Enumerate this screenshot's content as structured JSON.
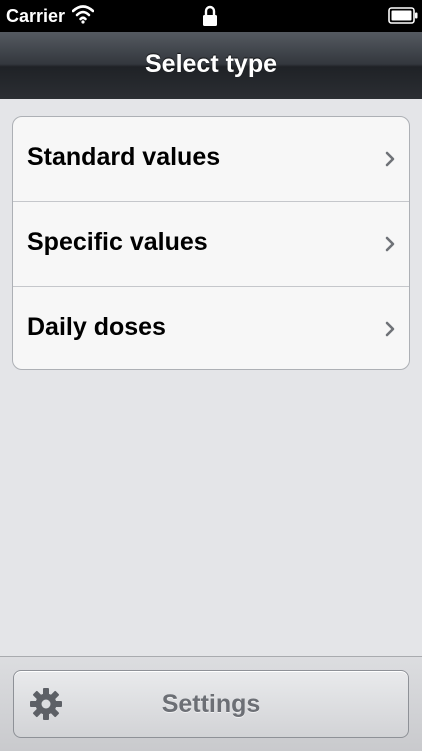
{
  "status_bar": {
    "carrier": "Carrier"
  },
  "navbar": {
    "title": "Select type"
  },
  "list": {
    "items": [
      {
        "label": "Standard values"
      },
      {
        "label": "Specific values"
      },
      {
        "label": "Daily doses"
      }
    ]
  },
  "toolbar": {
    "settings_label": "Settings"
  },
  "icons": {
    "wifi": "wifi-icon",
    "lock": "lock-icon",
    "battery": "battery-icon",
    "chevron": "chevron-right-icon",
    "gear": "gear-icon"
  }
}
